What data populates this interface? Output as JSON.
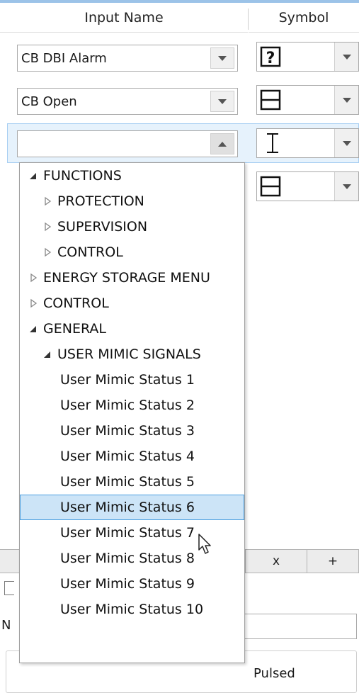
{
  "columns": {
    "input_name": "Input Name",
    "symbol": "Symbol"
  },
  "rows": [
    {
      "input_value": "CB DBI Alarm",
      "symbol_icon": "question-box-icon"
    },
    {
      "input_value": "CB Open",
      "symbol_icon": "horizontal-split-box-icon"
    },
    {
      "input_value": "",
      "symbol_icon": "i-beam-icon"
    },
    {
      "input_value": "",
      "symbol_icon": "horizontal-split-box-icon"
    }
  ],
  "dropdown": {
    "items": [
      {
        "label": "FUNCTIONS",
        "state": "expanded"
      },
      {
        "label": "PROTECTION",
        "state": "collapsed"
      },
      {
        "label": "SUPERVISION",
        "state": "collapsed"
      },
      {
        "label": "CONTROL",
        "state": "collapsed"
      },
      {
        "label": "ENERGY STORAGE MENU",
        "state": "collapsed"
      },
      {
        "label": "CONTROL",
        "state": "collapsed"
      },
      {
        "label": "GENERAL",
        "state": "expanded"
      },
      {
        "label": "USER MIMIC SIGNALS",
        "state": "expanded"
      },
      {
        "label": "User Mimic Status 1"
      },
      {
        "label": "User Mimic Status 2"
      },
      {
        "label": "User Mimic Status 3"
      },
      {
        "label": "User Mimic Status 4"
      },
      {
        "label": "User Mimic Status 5"
      },
      {
        "label": "User Mimic Status 6",
        "selected": true
      },
      {
        "label": "User Mimic Status 7"
      },
      {
        "label": "User Mimic Status 8"
      },
      {
        "label": "User Mimic Status 9"
      },
      {
        "label": "User Mimic Status 10"
      }
    ]
  },
  "background": {
    "remove_label": "x",
    "add_label": "+",
    "partial_label_n": "N",
    "pulsed_label": "Pulsed"
  },
  "colors": {
    "selection": "#cce4f7",
    "selection_border": "#4a9ee0",
    "row_highlight": "#e6f2fc"
  }
}
